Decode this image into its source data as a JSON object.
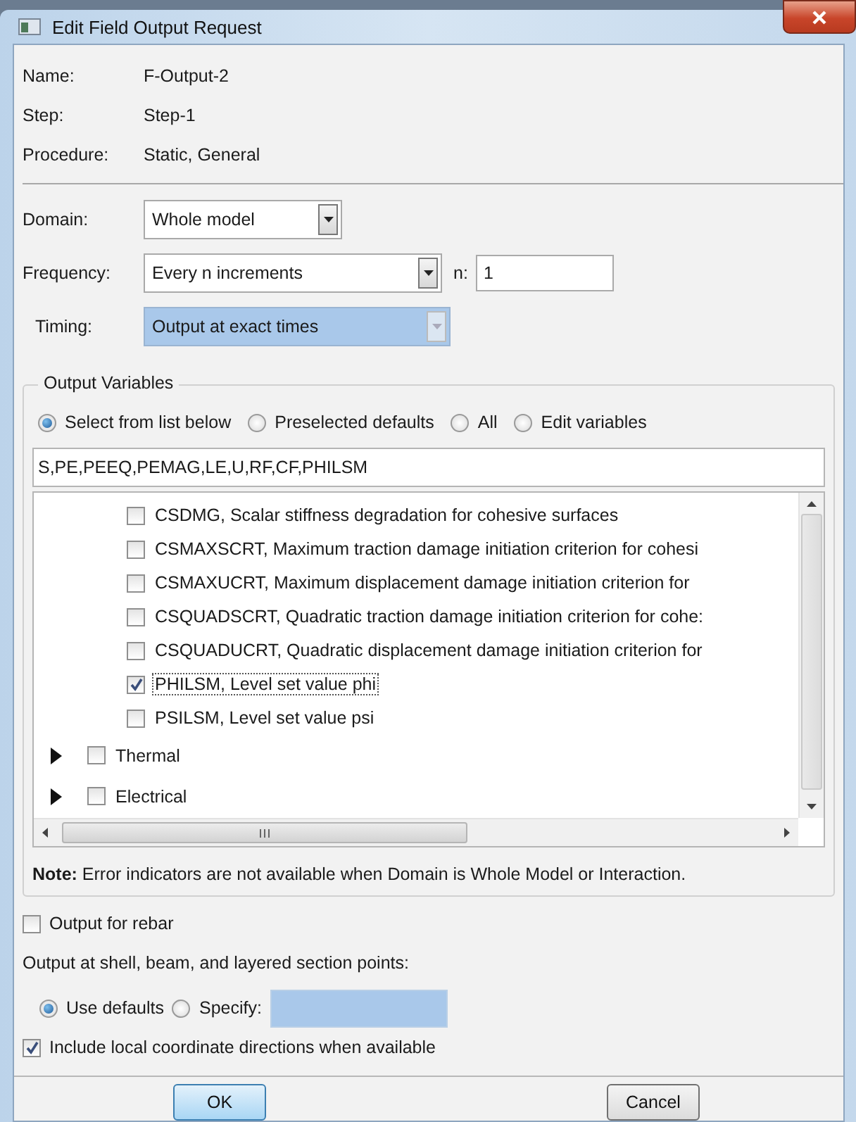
{
  "window": {
    "title": "Edit Field Output Request"
  },
  "info": [
    {
      "label": "Name:",
      "value": "F-Output-2"
    },
    {
      "label": "Step:",
      "value": "Step-1"
    },
    {
      "label": "Procedure:",
      "value": "Static, General"
    }
  ],
  "domain": {
    "label": "Domain:",
    "value": "Whole model"
  },
  "frequency": {
    "label": "Frequency:",
    "value": "Every n increments",
    "n_label": "n:",
    "n_value": "1"
  },
  "timing": {
    "label": "Timing:",
    "value": "Output at exact times",
    "focused": true
  },
  "output_variables": {
    "title": "Output Variables",
    "options": [
      {
        "label": "Select from list below",
        "selected": true
      },
      {
        "label": "Preselected defaults",
        "selected": false
      },
      {
        "label": "All",
        "selected": false
      },
      {
        "label": "Edit variables",
        "selected": false
      }
    ],
    "text": "S,PE,PEEQ,PEMAG,LE,U,RF,CF,PHILSM",
    "rows": [
      {
        "kind": "variable",
        "label": "CSDMG, Scalar stiffness degradation for cohesive surfaces",
        "checked": false,
        "focused": false
      },
      {
        "kind": "variable",
        "label": "CSMAXSCRT, Maximum traction damage initiation criterion for cohesi",
        "checked": false,
        "focused": false
      },
      {
        "kind": "variable",
        "label": "CSMAXUCRT, Maximum displacement damage initiation criterion for",
        "checked": false,
        "focused": false
      },
      {
        "kind": "variable",
        "label": "CSQUADSCRT, Quadratic traction damage initiation criterion for cohe:",
        "checked": false,
        "focused": false
      },
      {
        "kind": "variable",
        "label": "CSQUADUCRT, Quadratic displacement damage initiation criterion for",
        "checked": false,
        "focused": false
      },
      {
        "kind": "variable",
        "label": "PHILSM, Level set value phi",
        "checked": true,
        "focused": true
      },
      {
        "kind": "variable",
        "label": "PSILSM, Level set value psi",
        "checked": false,
        "focused": false
      },
      {
        "kind": "category",
        "label": "Thermal",
        "checked": false,
        "expanded": false,
        "focused": false
      },
      {
        "kind": "category",
        "label": "Electrical",
        "checked": false,
        "expanded": false,
        "focused": false
      }
    ],
    "note": "**Note:**  Error indicators are not available when Domain is Whole Model or Interaction."
  },
  "rebar": {
    "label": "Output for rebar",
    "checked": false
  },
  "section_points": {
    "label": "Output at shell, beam, and layered section points:",
    "options": [
      {
        "label": "Use defaults",
        "selected": true
      },
      {
        "label": "Specify:",
        "selected": false
      }
    ]
  },
  "local_coords": {
    "label": "Include local coordinate directions when available",
    "checked": true
  },
  "buttons": [
    {
      "label": "OK",
      "default": true
    },
    {
      "label": "Cancel",
      "default": false
    }
  ]
}
